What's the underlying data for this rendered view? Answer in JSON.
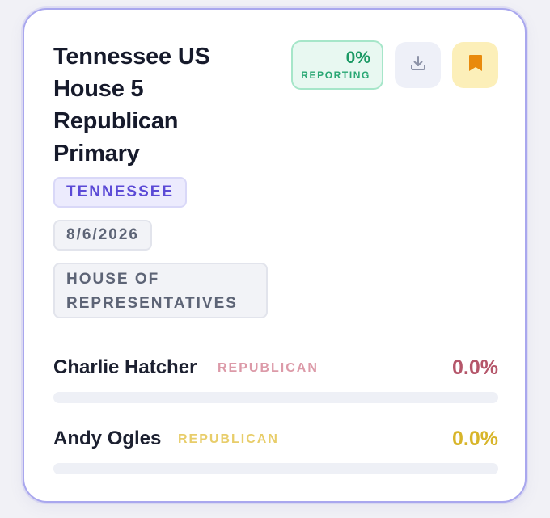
{
  "race": {
    "title": "Tennessee US House 5 Republican Primary",
    "reporting_pct": "0%",
    "reporting_label": "REPORTING",
    "reporting_fraction": 0.0,
    "state_tag": "TENNESSEE",
    "date_tag": "8/6/2026",
    "office_tag": "HOUSE OF REPRESENTATIVES"
  },
  "actions": {
    "download_icon": "download-icon",
    "bookmark_icon": "bookmark-icon"
  },
  "candidates": [
    {
      "name": "Charlie Hatcher",
      "party": "REPUBLICAN",
      "pct": "0.0%",
      "share": 0.0,
      "party_color": "#dc9aa8",
      "pct_color": "#b5566a"
    },
    {
      "name": "Andy Ogles",
      "party": "REPUBLICAN",
      "pct": "0.0%",
      "share": 0.0,
      "party_color": "#e8cd6a",
      "pct_color": "#d8b52a"
    }
  ],
  "colors": {
    "accent": "#5b4ad6",
    "reporting_green": "#1c9a65",
    "bookmark_orange": "#e98a0c"
  }
}
